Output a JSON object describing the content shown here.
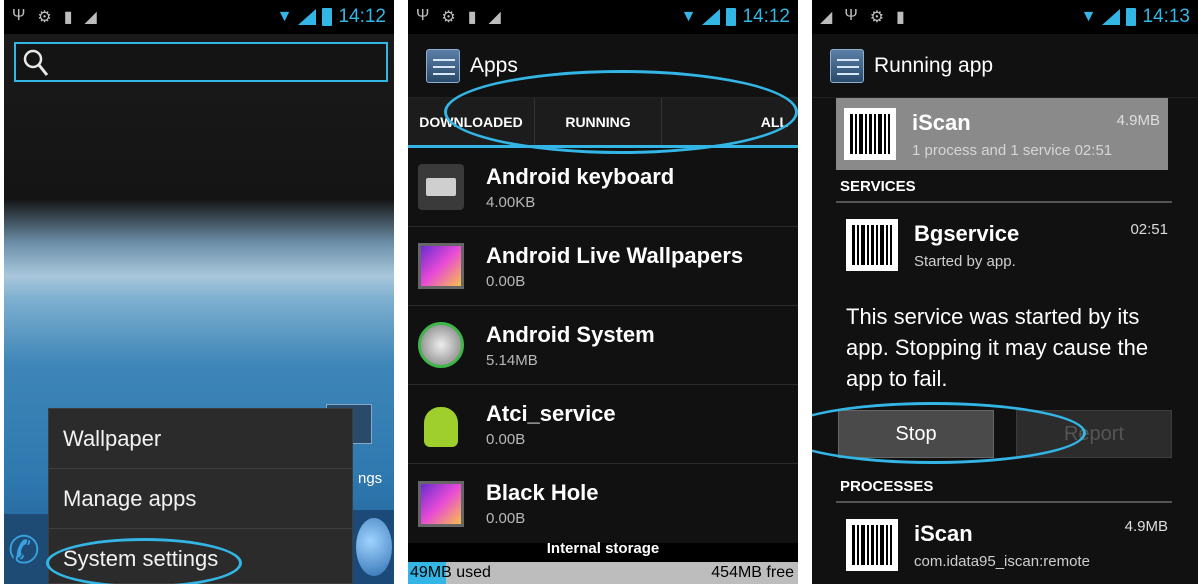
{
  "status": {
    "time1": "14:12",
    "time2": "14:12",
    "time3": "14:13"
  },
  "home": {
    "menu": [
      "Wallpaper",
      "Manage apps",
      "System settings"
    ],
    "settings_partial_label": "ngs"
  },
  "apps": {
    "title": "Apps",
    "tabs": [
      "DOWNLOADED",
      "RUNNING",
      "ALL"
    ],
    "items": [
      {
        "name": "Android keyboard",
        "size": "4.00KB"
      },
      {
        "name": "Android Live Wallpapers",
        "size": "0.00B"
      },
      {
        "name": "Android System",
        "size": "5.14MB"
      },
      {
        "name": "Atci_service",
        "size": "0.00B"
      },
      {
        "name": "Black Hole",
        "size": "0.00B"
      }
    ],
    "storage_label": "Internal storage",
    "used": "49MB used",
    "free": "454MB free",
    "used_fraction": 0.097
  },
  "running": {
    "title": "Running app",
    "top_app": {
      "name": "iScan",
      "size": "4.9MB",
      "sub": "1 process and 1 service",
      "time": "02:51"
    },
    "services_header": "SERVICES",
    "service": {
      "name": "Bgservice",
      "time": "02:51",
      "sub": "Started by app."
    },
    "description": "This service was started by its app. Stopping it may cause the app to fail.",
    "stop_label": "Stop",
    "report_label": "Report",
    "processes_header": "PROCESSES",
    "process": {
      "name": "iScan",
      "size": "4.9MB",
      "sub": "com.idata95_iscan:remote"
    }
  }
}
